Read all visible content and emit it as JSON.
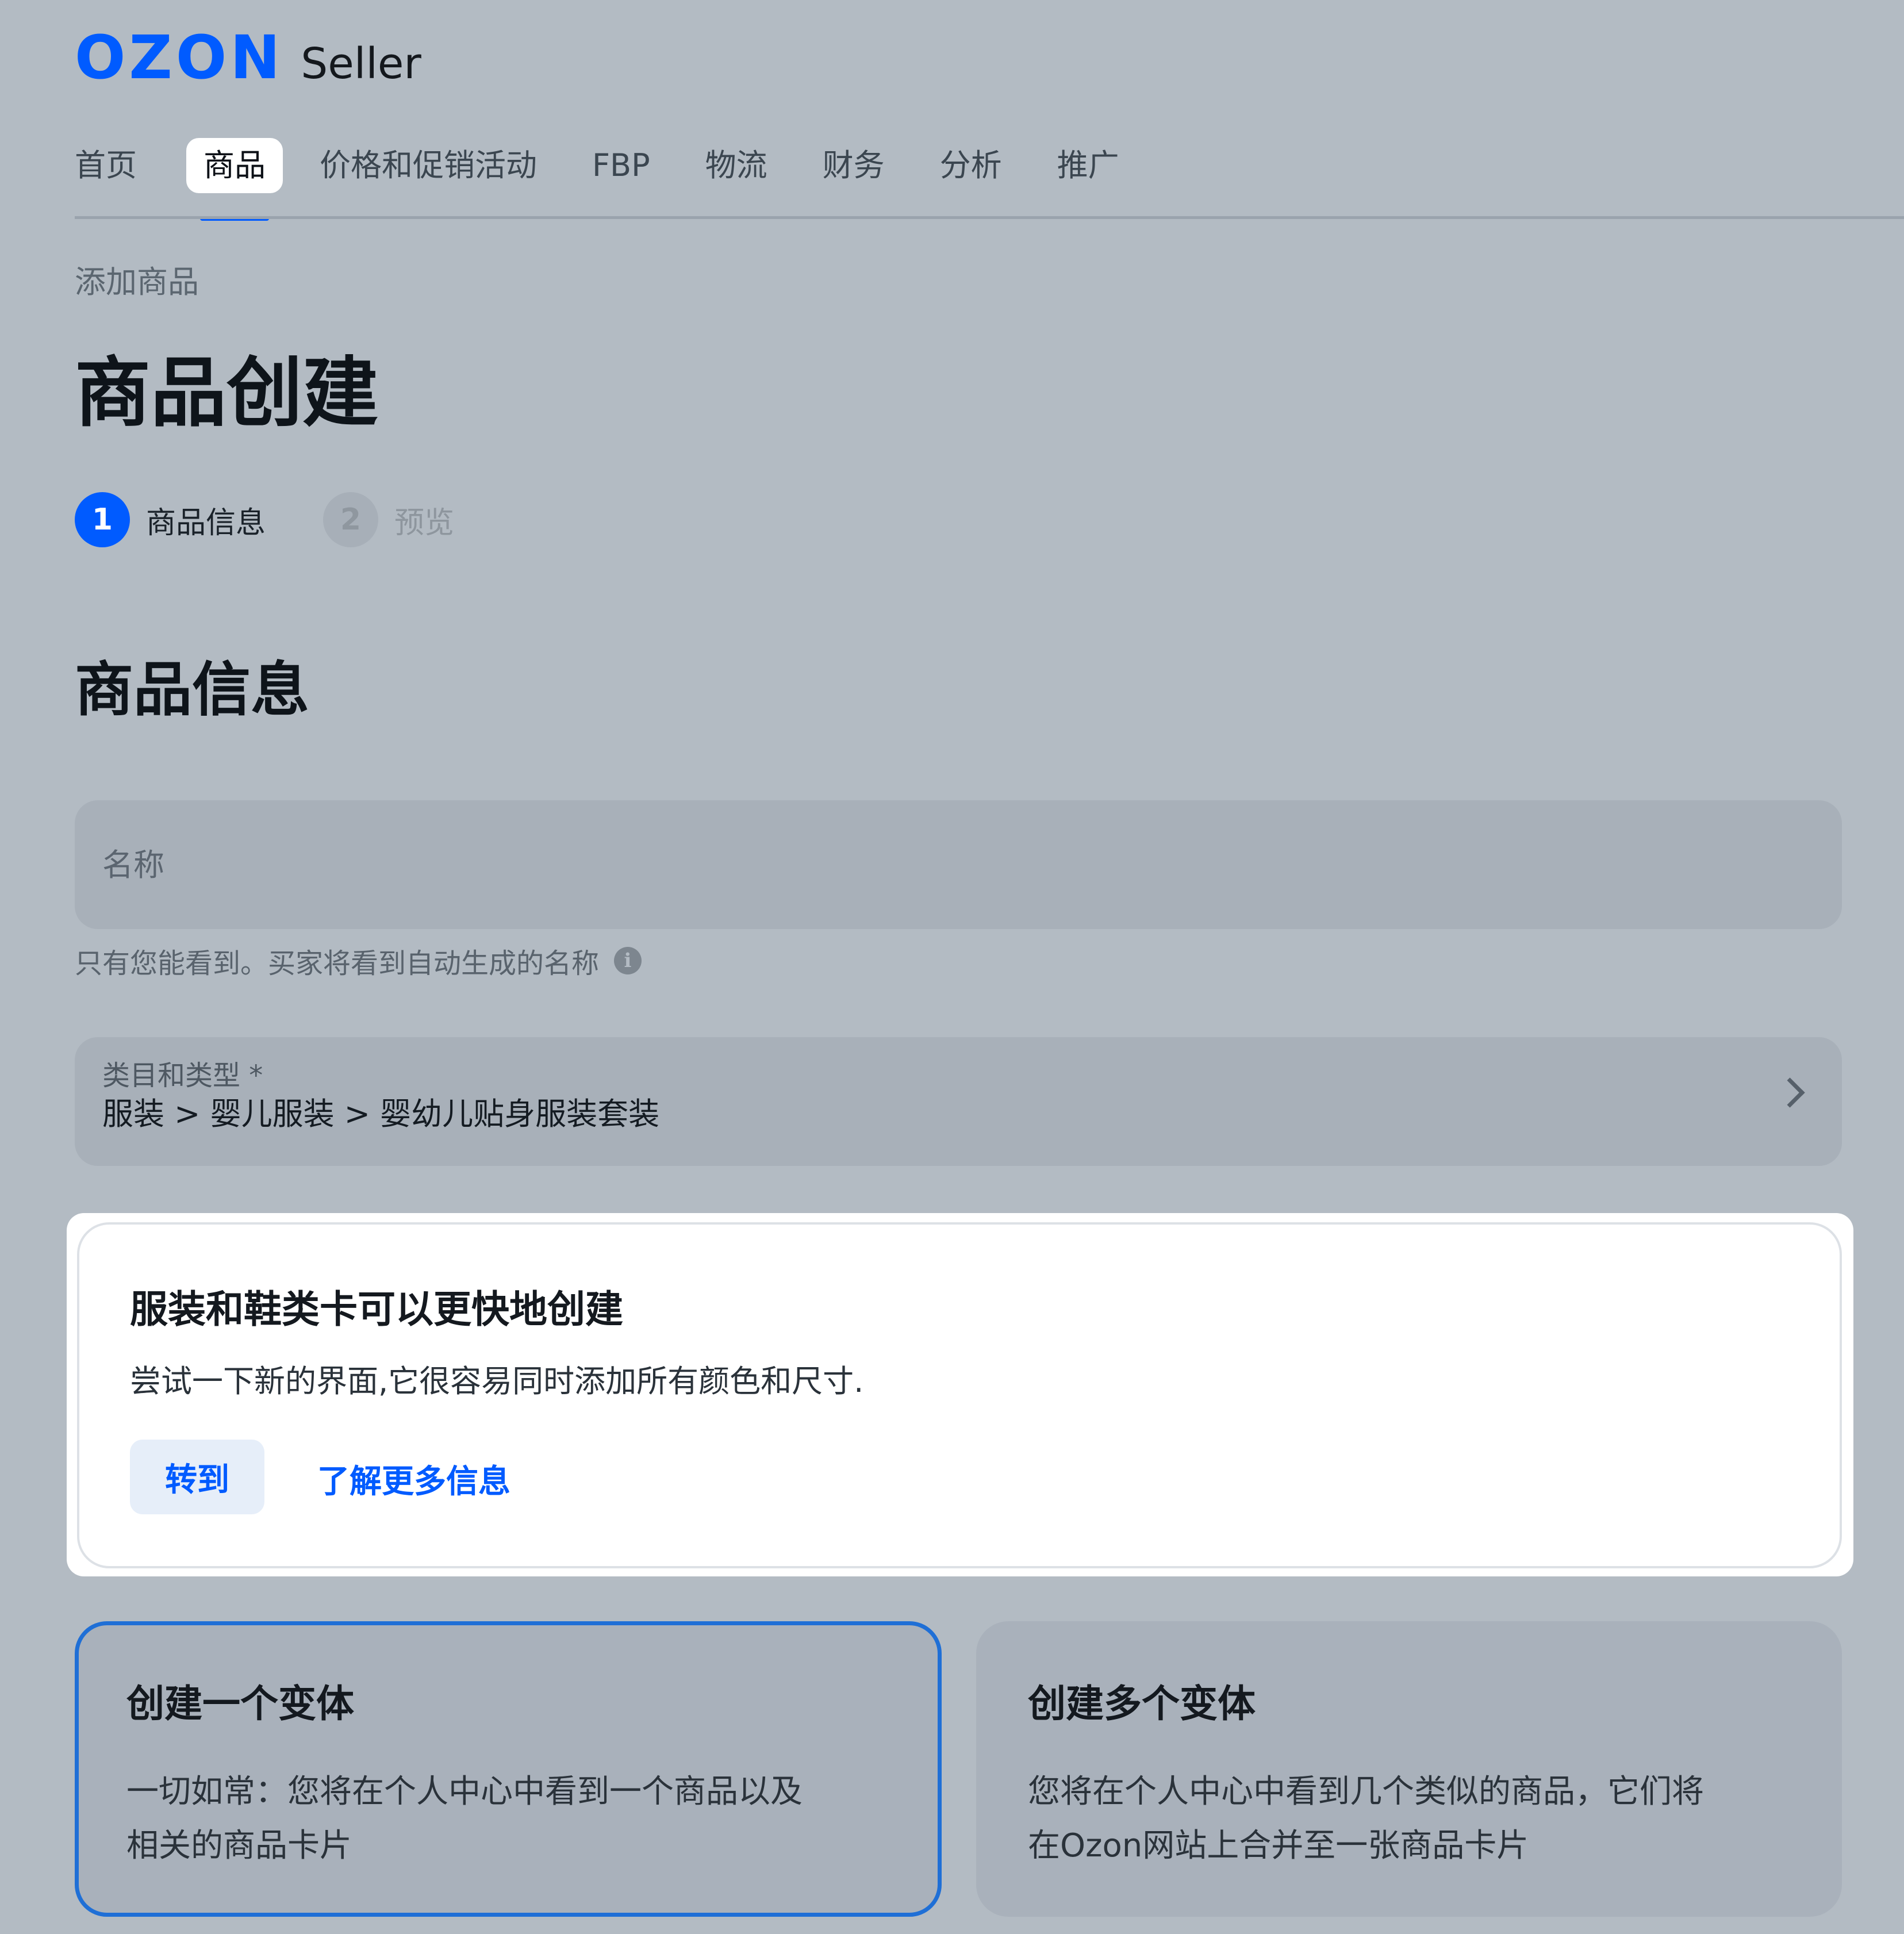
{
  "header": {
    "logo_brand": "OZON",
    "logo_product": "Seller"
  },
  "nav": {
    "items": [
      {
        "label": "首页",
        "active": false
      },
      {
        "label": "商品",
        "active": true
      },
      {
        "label": "价格和促销活动",
        "active": false
      },
      {
        "label": "FBP",
        "active": false
      },
      {
        "label": "物流",
        "active": false
      },
      {
        "label": "财务",
        "active": false
      },
      {
        "label": "分析",
        "active": false
      },
      {
        "label": "推广",
        "active": false
      }
    ]
  },
  "breadcrumb": "添加商品",
  "page_title": "商品创建",
  "stepper": {
    "steps": [
      {
        "number": "1",
        "label": "商品信息",
        "active": true
      },
      {
        "number": "2",
        "label": "预览",
        "active": false
      }
    ]
  },
  "section_title": "商品信息",
  "name_field": {
    "placeholder": "名称",
    "value": "",
    "hint": "只有您能看到。买家将看到自动生成的名称"
  },
  "category_field": {
    "label": "类目和类型 *",
    "value": "服装 > 婴儿服装 > 婴幼儿贴身服装套装"
  },
  "promo": {
    "title": "服装和鞋类卡可以更快地创建",
    "description": "尝试一下新的界面,它很容易同时添加所有颜色和尺寸.",
    "button_label": "转到",
    "link_label": "了解更多信息"
  },
  "options": [
    {
      "title": "创建一个变体",
      "line1": "一切如常：您将在个人中心中看到一个商品以及",
      "line2": "相关的商品卡片",
      "selected": true
    },
    {
      "title": "创建多个变体",
      "line1": "您将在个人中心中看到几个类似的商品，它们将",
      "line2": "在Ozon网站上合并至一张商品卡片",
      "selected": false
    }
  ],
  "colors": {
    "brand": "#005bff",
    "selected_border": "#1f6fd6",
    "background": "#b3bbc3"
  }
}
